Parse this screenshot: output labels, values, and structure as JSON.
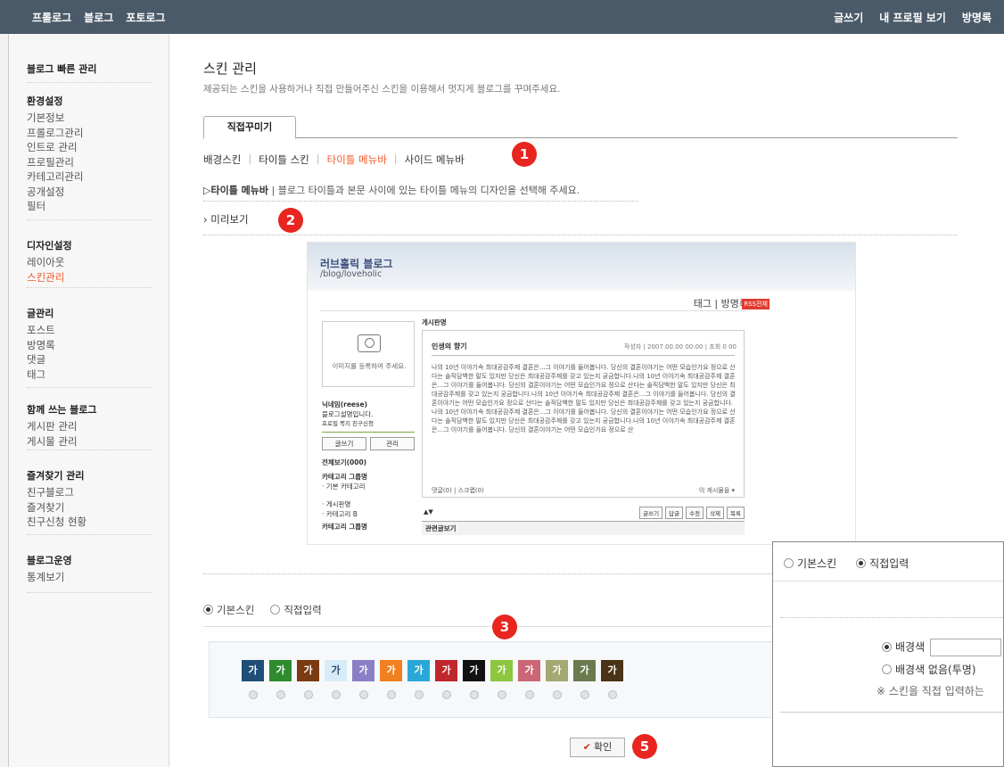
{
  "topbar": {
    "left": [
      "프롤로그",
      "블로그",
      "포토로그"
    ],
    "right": [
      "글쓰기",
      "내 프로필 보기",
      "방명록"
    ]
  },
  "sidebar": {
    "quick": "블로그 빠른 관리",
    "groups": [
      {
        "title": "환경설정",
        "items": [
          "기본정보",
          "프롤로그관리",
          "인트로 관리",
          "프로필관리",
          "카테고리관리",
          "공개설정",
          "필터"
        ]
      },
      {
        "title": "디자인설정",
        "items": [
          "레이아웃",
          "스킨관리"
        ]
      },
      {
        "title": "글관리",
        "items": [
          "포스트",
          "방명록",
          "댓글",
          "태그"
        ]
      },
      {
        "title": "함께 쓰는 블로그",
        "items": [
          "게시판 관리",
          "게시물 관리"
        ]
      },
      {
        "title": "즐겨찾기 관리",
        "items": [
          "친구블로그",
          "즐겨찾기",
          "친구신청 현황"
        ]
      },
      {
        "title": "블로그운영",
        "items": [
          "통계보기"
        ]
      }
    ],
    "active_item": "스킨관리"
  },
  "main": {
    "title": "스킨 관리",
    "description": "제공되는 스킨을 사용하거나 직접 만들어주신 스킨을 이용해서 멋지게 블로그를 꾸며주세요.",
    "tab": "직접꾸미기",
    "subnav": [
      "배경스킨",
      "타이틀 스킨",
      "타이틀 메뉴바",
      "사이드 메뉴바"
    ],
    "subnav_active": "타이틀 메뉴바",
    "info_title": "▷타이틀 메뉴바",
    "info_text": "| 블로그 타이틀과 본문 사이에 있는 타이틀 메뉴의 디자인을 선택해 주세요.",
    "preview_label": "› 미리보기",
    "badges": [
      "1",
      "2",
      "3",
      "5"
    ]
  },
  "preview": {
    "blog_title": "러브홀릭 블로그",
    "blog_url": "/blog/loveholic",
    "links": "태그 | 방명록",
    "rss": "RSS전체",
    "photo_text": "이미지를 등록하여 주세요.",
    "profile_name": "닉네임(reese)",
    "profile_desc": "블로그설명입니다.",
    "profile_links": "프로필  쪽지  친구신청",
    "btn_write": "글쓰기",
    "btn_manage": "관리",
    "all_view": "전체보기(000)",
    "cat_group": "카테고리 그룹명",
    "cat_default": "· 기본 카테고리",
    "cat_items": "· 게시판명\n· 카테고리 B",
    "cat_group2": "카테고리 그룹명",
    "post_board": "게시판명",
    "post_title": "인생의 향기",
    "post_meta": "작성자 | 2007.00.00 00:00 | 조회 0 00",
    "post_body": "나의 10년 이야기속 최대공감주제 결혼은...그 이야기를 들어봅니다. 당신의 결혼이야기는 어떤 모습인가요 정으로 산다는 솔직담백한 말도 있지만 당신은 최대공감주제를 갖고 있는지 궁금합니다.나의 10년 이야기속 최대공감주제 결혼은...그 이야기를 들어봅니다. 당신의 결혼이야기는 어떤 모습인가요 정으로 산다는 솔직담백한 말도 있지만 당신은 최대공감주제를 갖고 있는지 궁금합니다.나의 10년 이야기속 최대공감주제 결혼은...그 이야기를 들어봅니다. 당신의 결혼이야기는 어떤 모습인가요 정으로 산다는 솔직담백한 말도 있지만 당신은 최대공감주제를 갖고 있는지 궁금합니다.나의 10년 이야기속 최대공감주제 결혼은...그 이야기를 들어봅니다. 당신의 결혼이야기는 어떤 모습인가요 정으로 산다는 솔직담백한 말도 있지만 당신은 최대공감주제를 갖고 있는지 궁금합니다.나의 10년 이야기속 최대공감주제 결혼은...그 이야기를 들어봅니다. 당신의 결혼이야기는 어떤 모습인가요 정으로 산",
    "post_comments": "댓글(0) | 스크랩(0)",
    "post_list": "이 게시물을 ▾",
    "toolbar_arrows": "▲▼",
    "toolbar": [
      "글쓰기",
      "답글",
      "수정",
      "삭제",
      "목록"
    ],
    "related": "관련글보기"
  },
  "skin_options": {
    "radio_default": "기본스킨",
    "radio_custom": "직접입력",
    "selected": "기본스킨",
    "swatch_label": "가",
    "swatch_colors": [
      "#1f4e79",
      "#2e8b2e",
      "#7a3b12",
      "#d8ecf8",
      "#8a7fc4",
      "#f08020",
      "#29a8d8",
      "#c0272d",
      "#111111",
      "#8dc63f",
      "#cc6677",
      "#a5a872",
      "#6b7a4f",
      "#4a3316"
    ],
    "swatch_text_colors": [
      "#ffffff",
      "#ffffff",
      "#ffffff",
      "#2b4a70",
      "#ffffff",
      "#ffffff",
      "#ffffff",
      "#ffffff",
      "#ffffff",
      "#ffffff",
      "#ffffff",
      "#ffffff",
      "#ffffff",
      "#ffffff"
    ],
    "ok_label": "확인"
  },
  "popup": {
    "radio_default": "기본스킨",
    "radio_custom": "직접입력",
    "selected": "직접입력",
    "bg_color": "배경색",
    "bg_none": "배경색 없음(투명)",
    "note": "※ 스킨을 직접 입력하는"
  },
  "colors": {
    "topbar": "#4a5a68",
    "accent": "#f2582a",
    "badge": "#e8251f"
  }
}
